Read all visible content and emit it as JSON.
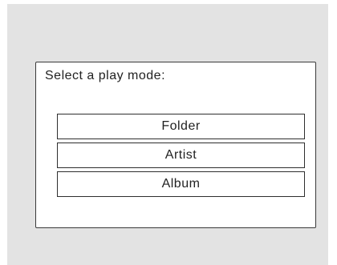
{
  "dialog": {
    "prompt": "Select a play mode:",
    "options": [
      {
        "label": "Folder"
      },
      {
        "label": "Artist"
      },
      {
        "label": "Album"
      }
    ]
  }
}
